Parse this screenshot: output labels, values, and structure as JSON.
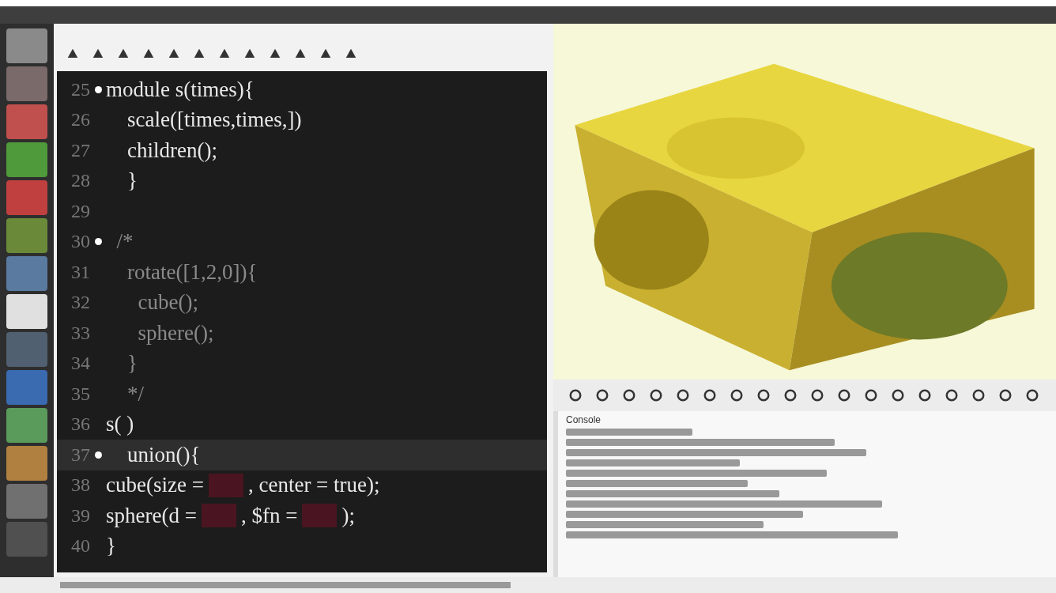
{
  "editor": {
    "lines": [
      {
        "number": "25",
        "marker": true,
        "current": false,
        "segments": [
          {
            "kind": "code",
            "text": "module s(times){"
          }
        ]
      },
      {
        "number": "26",
        "marker": false,
        "current": false,
        "segments": [
          {
            "kind": "code",
            "text": "    scale([times,times,"
          },
          {
            "kind": "code",
            "text": "])"
          }
        ]
      },
      {
        "number": "27",
        "marker": false,
        "current": false,
        "segments": [
          {
            "kind": "code",
            "text": "    children();"
          }
        ]
      },
      {
        "number": "28",
        "marker": false,
        "current": false,
        "segments": [
          {
            "kind": "code",
            "text": "    }"
          }
        ]
      },
      {
        "number": "29",
        "marker": false,
        "current": false
      },
      {
        "number": "30",
        "marker": true,
        "current": false,
        "segments": [
          {
            "kind": "comment",
            "text": "  /*"
          }
        ]
      },
      {
        "number": "31",
        "marker": false,
        "current": false,
        "segments": [
          {
            "kind": "comment",
            "text": "    rotate([1,2,0]){"
          }
        ]
      },
      {
        "number": "32",
        "marker": false,
        "current": false,
        "segments": [
          {
            "kind": "comment",
            "text": "      cube();"
          }
        ]
      },
      {
        "number": "33",
        "marker": false,
        "current": false,
        "segments": [
          {
            "kind": "comment",
            "text": "      sphere();"
          }
        ]
      },
      {
        "number": "34",
        "marker": false,
        "current": false,
        "segments": [
          {
            "kind": "comment",
            "text": "    }"
          }
        ]
      },
      {
        "number": "35",
        "marker": false,
        "current": false,
        "segments": [
          {
            "kind": "comment",
            "text": "    */"
          }
        ]
      },
      {
        "number": "36",
        "marker": false,
        "current": false,
        "segments": [
          {
            "kind": "code",
            "text": "s( )"
          }
        ]
      },
      {
        "number": "37",
        "marker": true,
        "current": true,
        "segments": [
          {
            "kind": "code",
            "text": "    union(){"
          }
        ]
      },
      {
        "number": "38",
        "marker": false,
        "current": false,
        "segments": [
          {
            "kind": "code",
            "text": "cube(size ="
          },
          {
            "kind": "blank"
          },
          {
            "kind": "code",
            "text": ", center = true);"
          }
        ]
      },
      {
        "number": "39",
        "marker": false,
        "current": false,
        "segments": [
          {
            "kind": "code",
            "text": "sphere(d ="
          },
          {
            "kind": "blank"
          },
          {
            "kind": "code",
            "text": ", $fn ="
          },
          {
            "kind": "blank"
          },
          {
            "kind": "code",
            "text": ");"
          }
        ]
      },
      {
        "number": "40",
        "marker": false,
        "current": false,
        "segments": [
          {
            "kind": "code",
            "text": "}"
          }
        ]
      }
    ]
  },
  "console": {
    "title": "Console"
  }
}
